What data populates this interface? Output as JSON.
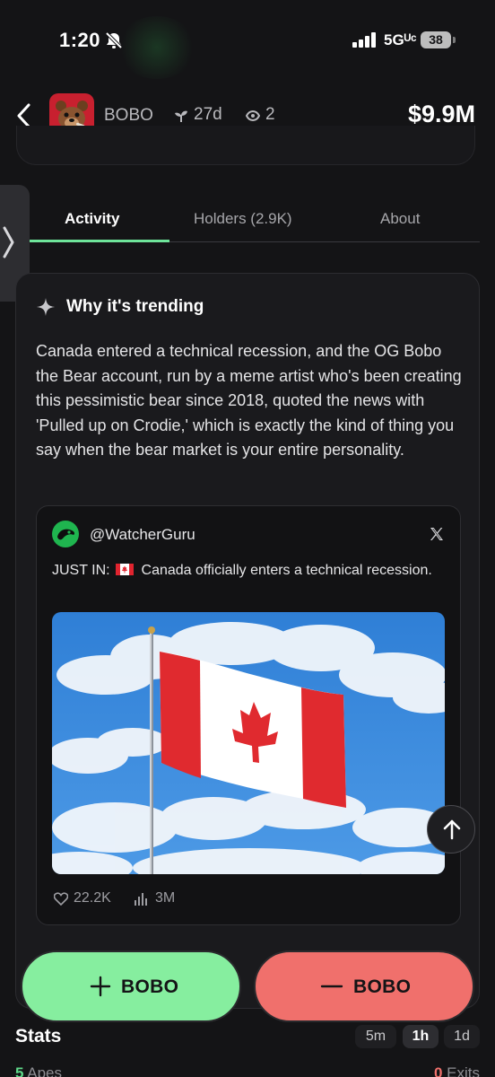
{
  "status_bar": {
    "time": "1:20",
    "network": "5Gᵁᶜ",
    "battery": "38"
  },
  "header": {
    "token_name": "BOBO",
    "age": "27d",
    "watchers": "2",
    "market_cap": "$9.9M"
  },
  "tabs": [
    {
      "label": "Activity",
      "active": true
    },
    {
      "label": "Holders (2.9K)",
      "active": false
    },
    {
      "label": "About",
      "active": false
    }
  ],
  "trending": {
    "title": "Why it's trending",
    "body": "Canada entered a technical recession, and the OG Bobo the Bear account, run by a meme artist who's been creating this pessimistic bear since 2018, quoted the news with 'Pulled up on Crodie,' which is exactly the kind of thing you say when the bear market is your entire personality."
  },
  "tweet": {
    "handle": "@WatcherGuru",
    "text_prefix": "JUST IN:",
    "text_rest": "Canada officially enters a technical recession.",
    "likes": "22.2K",
    "views": "3M"
  },
  "actions": {
    "buy_label": "BOBO",
    "sell_label": "BOBO"
  },
  "stats": {
    "title": "Stats",
    "ranges": [
      {
        "label": "5m",
        "active": false
      },
      {
        "label": "1h",
        "active": true
      },
      {
        "label": "1d",
        "active": false
      }
    ],
    "apes_count": "5",
    "apes_label": "Apes",
    "exits_count": "0",
    "exits_label": "Exits"
  },
  "colors": {
    "accent_green": "#86ee9f",
    "accent_red": "#f0706c",
    "tab_indicator": "#6ee49a"
  }
}
